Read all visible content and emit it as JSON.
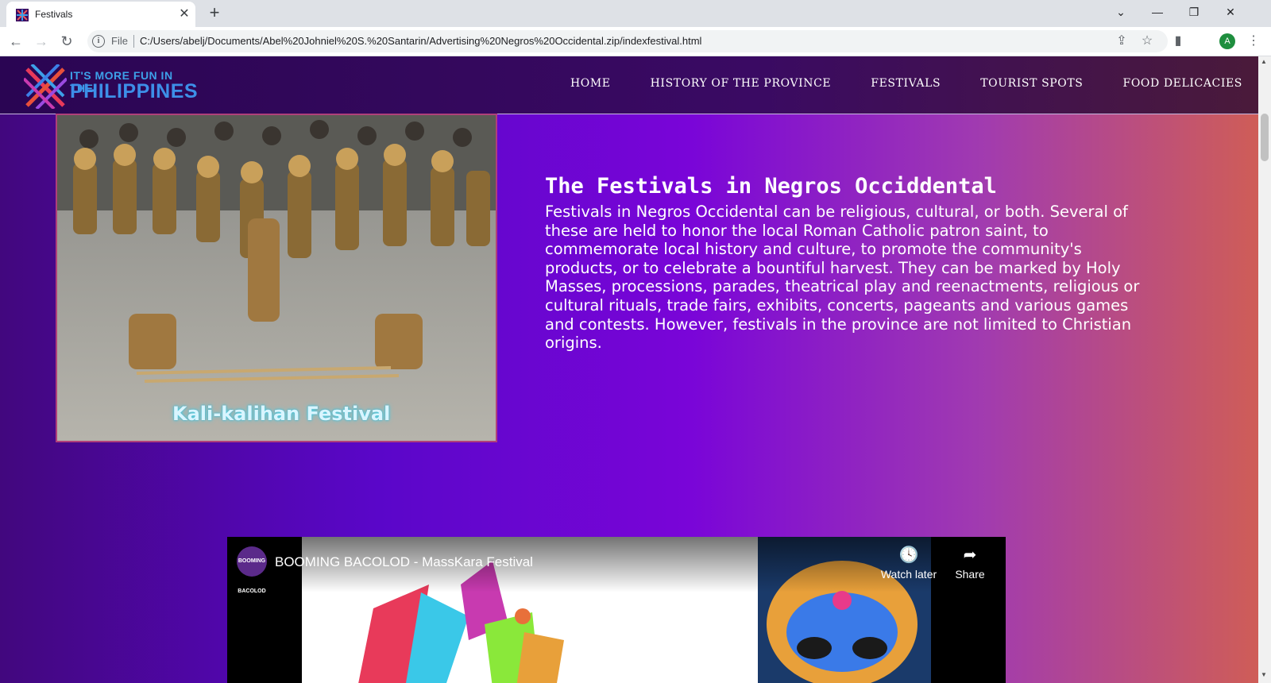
{
  "browser": {
    "tab_title": "Festivals",
    "tab_close": "✕",
    "new_tab": "+",
    "file_label": "File",
    "url": "C:/Users/abelj/Documents/Abel%20Johniel%20S.%20Santarin/Advertising%20Negros%20Occidental.zip/indexfestival.html",
    "avatar_letter": "A"
  },
  "site": {
    "logo_line1": "IT'S MORE FUN IN THE",
    "logo_line2": "PHILIPPINES",
    "nav": [
      "HOME",
      "HISTORY OF THE PROVINCE",
      "FESTIVALS",
      "TOURIST SPOTS",
      "FOOD DELICACIES"
    ]
  },
  "hero": {
    "image_caption": "Kali-kalihan Festival",
    "title": "The Festivals in Negros Occiddental",
    "body": "Festivals in Negros Occidental can be religious, cultural, or both. Several of these are held to honor the local Roman Catholic patron saint, to commemorate local history and culture, to promote the community's products, or to celebrate a bountiful harvest. They can be marked by Holy Masses, processions, parades, theatrical play and reenactments, religious or cultural rituals, trade fairs, exhibits, concerts, pageants and various games and contests. However, festivals in the province are not limited to Christian origins."
  },
  "video": {
    "channel_label": "BOOMING BACOLOD",
    "title": "BOOMING BACOLOD - MassKara Festival",
    "watch_later": "Watch later",
    "share": "Share"
  },
  "colors": {
    "gradient_left": "#42077e",
    "gradient_mid": "#7a05d8",
    "gradient_right": "#cf5d57",
    "header_bg": "#2a0553",
    "hero_border": "#b0407a"
  }
}
